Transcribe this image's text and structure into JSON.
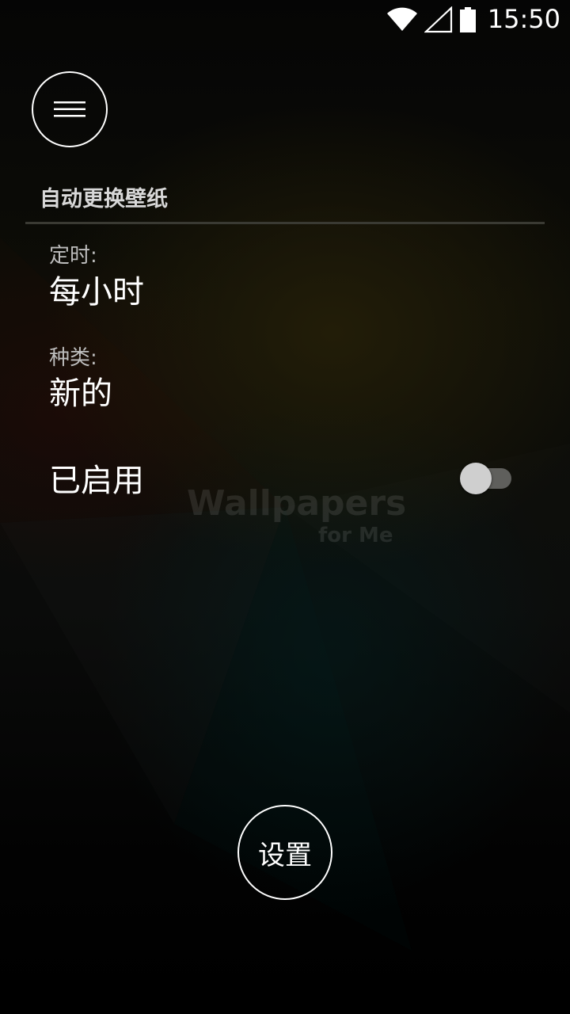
{
  "status_bar": {
    "time": "15:50",
    "icons": [
      "wifi-icon",
      "cell-signal-icon",
      "battery-icon"
    ]
  },
  "menu": {
    "icon": "hamburger-menu-icon"
  },
  "section": {
    "title": "自动更换壁纸"
  },
  "schedule": {
    "label": "定时:",
    "value": "每小时"
  },
  "category": {
    "label": "种类:",
    "value": "新的"
  },
  "enabled": {
    "label": "已启用",
    "checked": false
  },
  "watermark": {
    "main": "Wallpapers",
    "sub": "for Me"
  },
  "settings_button": {
    "label": "设置"
  },
  "colors": {
    "divider": "#3a3a33",
    "toggle_track": "#5f5f5c",
    "toggle_thumb": "#cfcfcf"
  }
}
